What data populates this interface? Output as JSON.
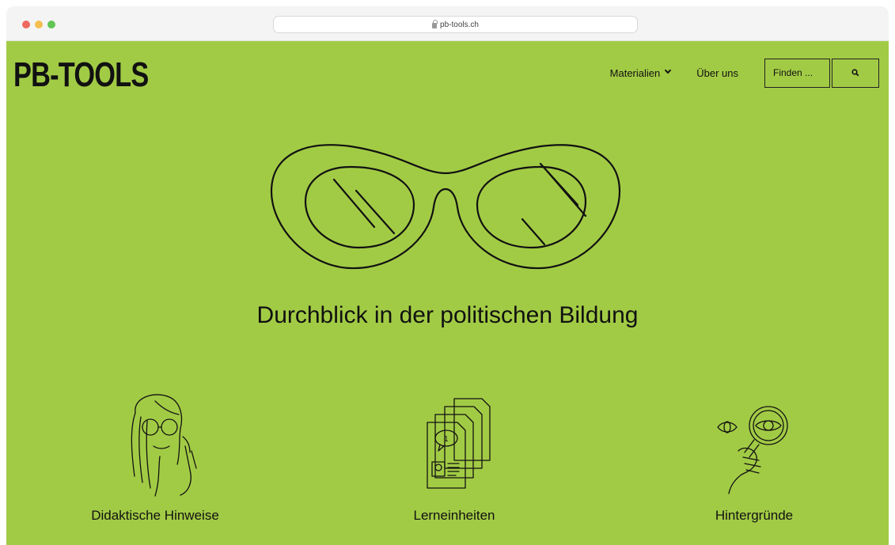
{
  "browser": {
    "url": "pb-tools.ch"
  },
  "header": {
    "logo": "PB-TOOLS",
    "nav": {
      "materialien": "Materialien",
      "ueber_uns": "Über uns"
    },
    "search": {
      "placeholder": "Finden ..."
    }
  },
  "hero": {
    "headline": "Durchblick in der politischen Bildung"
  },
  "features": [
    {
      "label": "Didaktische Hinweise",
      "icon": "woman-glasses-icon"
    },
    {
      "label": "Lerneinheiten",
      "icon": "documents-stack-icon"
    },
    {
      "label": "Hintergründe",
      "icon": "magnifying-glass-icon"
    }
  ],
  "colors": {
    "background": "#a2cb45",
    "ink": "#111111"
  }
}
